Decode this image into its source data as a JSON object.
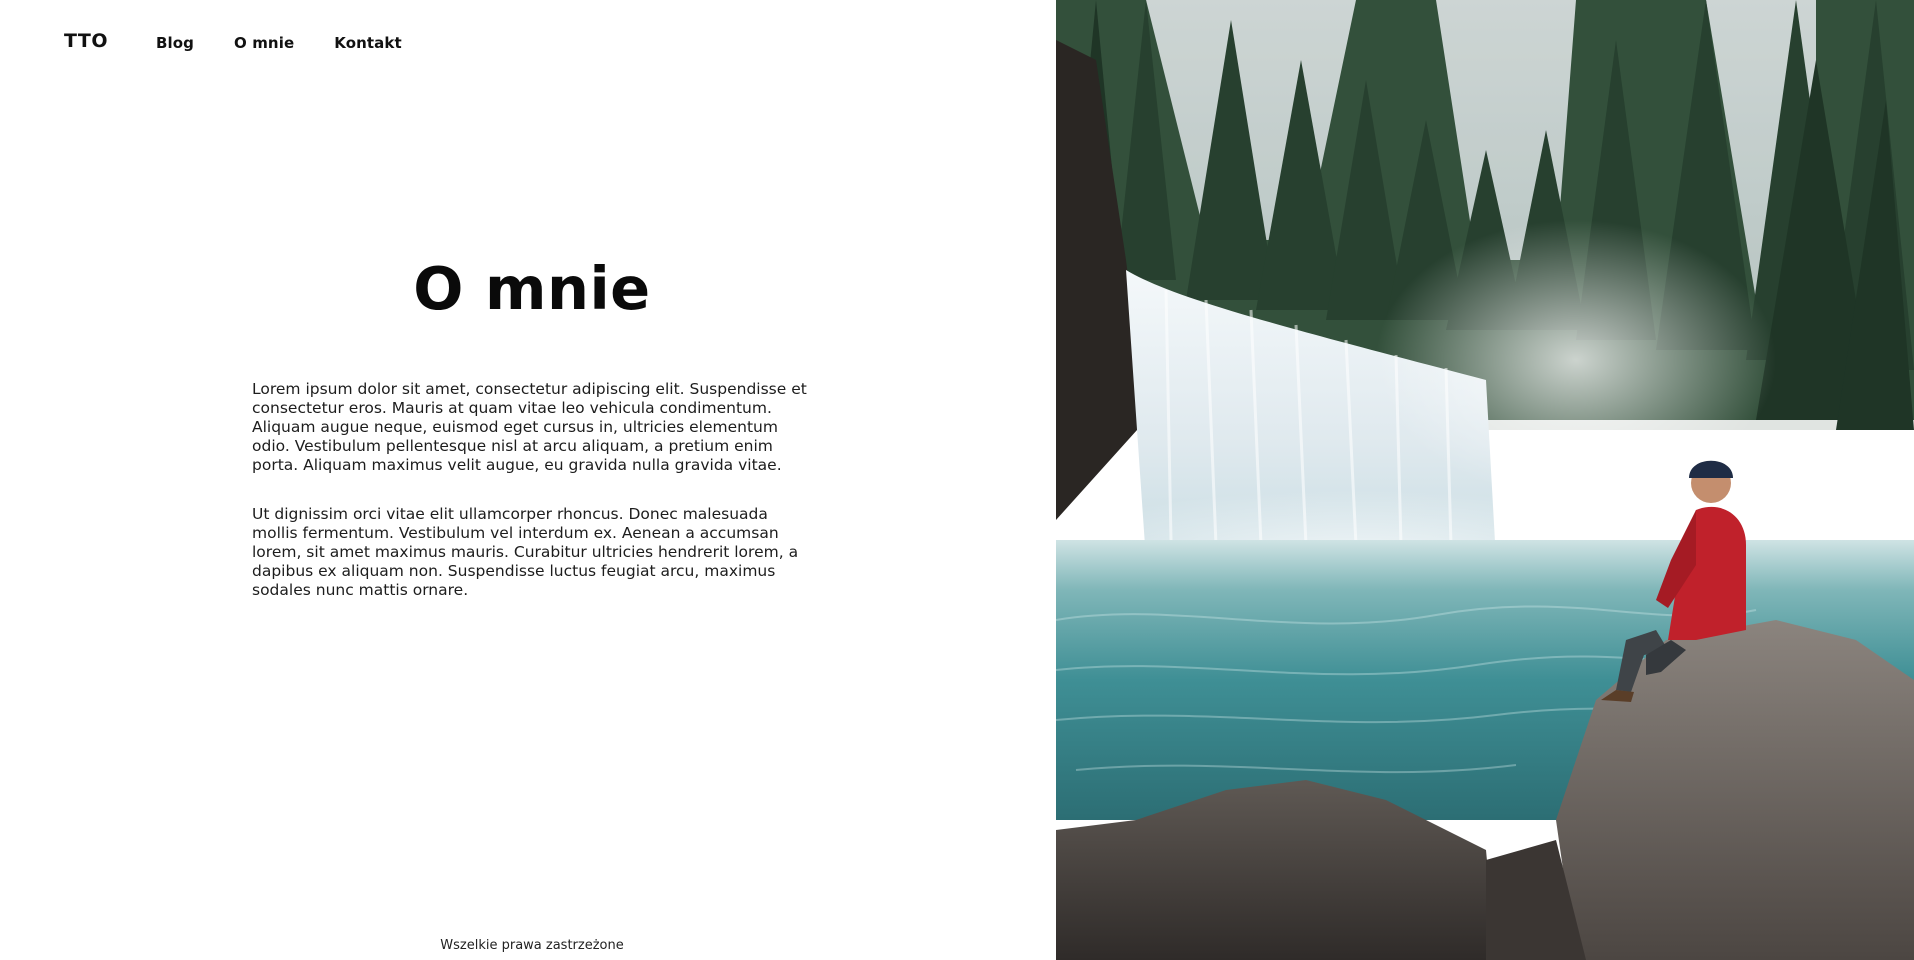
{
  "header": {
    "logo": "TTO",
    "nav": [
      {
        "label": "Blog"
      },
      {
        "label": "O mnie"
      },
      {
        "label": "Kontakt"
      }
    ]
  },
  "main": {
    "title": "O mnie",
    "paragraphs": [
      "Lorem ipsum dolor sit amet, consectetur adipiscing elit. Suspendisse et consectetur eros. Mauris at quam vitae leo vehicula condimentum. Aliquam augue neque, euismod eget cursus in, ultricies elementum odio. Vestibulum pellentesque nisl at arcu aliquam, a pretium enim porta. Aliquam maximus velit augue, eu gravida nulla gravida vitae.",
      "Ut dignissim orci vitae elit ullamcorper rhoncus. Donec malesuada mollis fermentum. Vestibulum vel interdum ex. Aenean a accumsan lorem, sit amet maximus mauris. Curabitur ultricies hendrerit lorem, a dapibus ex aliquam non. Suspendisse luctus feugiat arcu, maximus sodales nunc mattis ornare."
    ]
  },
  "footer": {
    "text": "Wszelkie prawa zastrzeżone"
  },
  "image": {
    "subject": "waterfall-with-hiker",
    "colors": {
      "forest": "#2f4a35",
      "water": "#3f8f95",
      "jacket": "#c0212b",
      "rock": "#6e6660"
    }
  }
}
